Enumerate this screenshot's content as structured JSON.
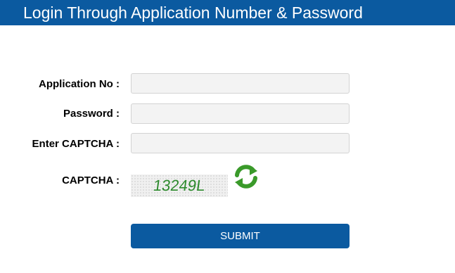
{
  "header": {
    "title": "Login Through Application Number & Password"
  },
  "form": {
    "application_no": {
      "label": "Application No :",
      "value": ""
    },
    "password": {
      "label": "Password :",
      "value": ""
    },
    "captcha_input": {
      "label": "Enter CAPTCHA :",
      "value": ""
    },
    "captcha": {
      "label": "CAPTCHA :",
      "code": "13249L"
    },
    "submit_label": "SUBMIT"
  },
  "colors": {
    "brand": "#0b5aa0",
    "captcha_text": "#2d8a2d",
    "refresh_icon": "#3a9a2a"
  },
  "icons": {
    "refresh": "refresh-icon"
  }
}
